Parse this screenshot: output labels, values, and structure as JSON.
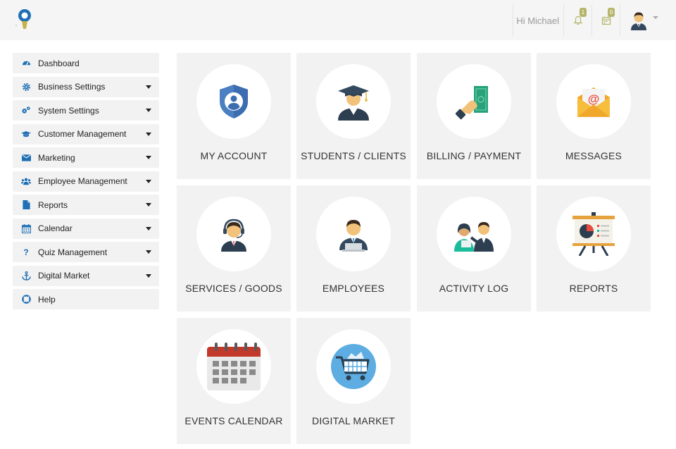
{
  "topbar": {
    "greeting": "Hi Michael",
    "notifications_count": "1",
    "calendar_count": "0",
    "icons": {
      "logo": "bulb-logo",
      "notify": "bell-icon",
      "calendar": "calendar-icon",
      "user": "avatar"
    }
  },
  "sidebar": {
    "items": [
      {
        "label": "Dashboard",
        "icon": "dashboard-icon",
        "has_caret": false
      },
      {
        "label": "Business Settings",
        "icon": "gear-icon",
        "has_caret": true
      },
      {
        "label": "System Settings",
        "icon": "gears-icon",
        "has_caret": true
      },
      {
        "label": "Customer Management",
        "icon": "graduation-cap-icon",
        "has_caret": true
      },
      {
        "label": "Marketing",
        "icon": "envelope-icon",
        "has_caret": true
      },
      {
        "label": "Employee Management",
        "icon": "users-icon",
        "has_caret": true
      },
      {
        "label": "Reports",
        "icon": "file-icon",
        "has_caret": true
      },
      {
        "label": "Calendar",
        "icon": "calendar-icon",
        "has_caret": true
      },
      {
        "label": "Quiz Management",
        "icon": "question-icon",
        "has_caret": true
      },
      {
        "label": "Digital Market",
        "icon": "anchor-icon",
        "has_caret": true
      },
      {
        "label": "Help",
        "icon": "lifebuoy-icon",
        "has_caret": false
      }
    ]
  },
  "tiles": [
    {
      "label": "MY ACCOUNT",
      "icon": "shield-user-icon"
    },
    {
      "label": "STUDENTS / CLIENTS",
      "icon": "graduate-icon"
    },
    {
      "label": "BILLING / PAYMENT",
      "icon": "payment-hand-icon"
    },
    {
      "label": "MESSAGES",
      "icon": "mail-at-icon"
    },
    {
      "label": "SERVICES / GOODS",
      "icon": "support-agent-icon"
    },
    {
      "label": "EMPLOYEES",
      "icon": "employee-laptop-icon"
    },
    {
      "label": "ACTIVITY LOG",
      "icon": "meeting-icon"
    },
    {
      "label": "REPORTS",
      "icon": "presentation-board-icon"
    },
    {
      "label": "EVENTS CALENDAR",
      "icon": "calendar-grid-icon"
    },
    {
      "label": "DIGITAL MARKET",
      "icon": "shopping-cart-icon"
    }
  ],
  "colors": {
    "accent": "#1f6fb5",
    "tile_bg": "#f2f2f2",
    "badge": "#b5b56a"
  }
}
